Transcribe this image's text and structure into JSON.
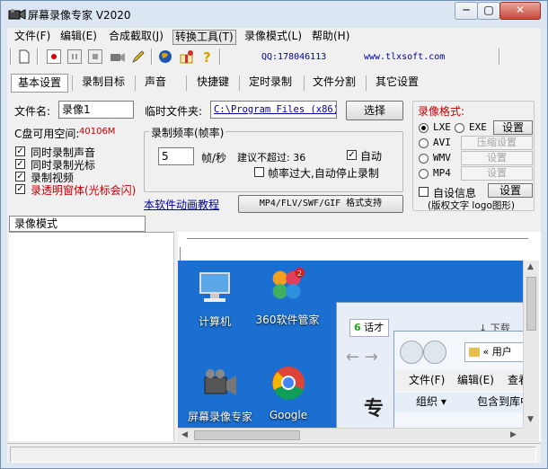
{
  "title": "屏幕录像专家 V2020",
  "window_controls": {
    "minimize": "─",
    "maximize": "▢",
    "close": "✕"
  },
  "menu": [
    "文件(F)",
    "编辑(E)",
    "合成截取(J)",
    "转换工具(T)",
    "录像模式(L)",
    "帮助(H)"
  ],
  "toolbar": {
    "qq": "QQ:178046113",
    "url": "www.tlxsoft.com"
  },
  "tabs": [
    "基本设置",
    "录制目标",
    "声音",
    "快捷键",
    "定时录制",
    "文件分割",
    "其它设置"
  ],
  "basic": {
    "filename_label": "文件名:",
    "filename_value": "录像1",
    "tempfolder_label": "临时文件夹:",
    "tempfolder_value": "C:\\Program Files (x86)\\",
    "browse_button": "选择",
    "disk_label": "C盘可用空间:",
    "disk_value": "40106M",
    "checkboxes": [
      {
        "label": "同时录制声音",
        "checked": true,
        "color": "#000000"
      },
      {
        "label": "同时录制光标",
        "checked": true,
        "color": "#000000"
      },
      {
        "label": "录制视频",
        "checked": true,
        "color": "#000000"
      },
      {
        "label": "录透明窗体(光标会闪)",
        "checked": true,
        "color": "#c00000"
      }
    ],
    "framerate": {
      "title": "录制频率(帧率)",
      "value": "5",
      "unit": "帧/秒",
      "suggest": "建议不超过: 36",
      "auto_label": "自动",
      "auto_checked": true,
      "stop_label": "帧率过大,自动停止录制",
      "stop_checked": false
    },
    "tutorial_link": "本软件动画教程",
    "format_button": "MP4/FLV/SWF/GIF  格式支持"
  },
  "format": {
    "title": "录像格式:",
    "options": [
      {
        "label": "LXE",
        "selected": true
      },
      {
        "label": "EXE",
        "selected": false
      },
      {
        "label": "AVI",
        "selected": false
      },
      {
        "label": "WMV",
        "selected": false
      },
      {
        "label": "MP4",
        "selected": false
      }
    ],
    "settings": "设置",
    "compress": "压缩设置",
    "custom_label": "自设信息",
    "custom_checked": false,
    "custom_button": "设置",
    "note": "(版权文字 logo图形)"
  },
  "recmode_tab": "录像模式",
  "desktop": {
    "icons": [
      "计算机",
      "360软件管家",
      "屏幕录像专家",
      "Google"
    ],
    "badge": "2",
    "browser_tabs": [
      "话才",
      "下载"
    ],
    "explorer": {
      "path": "用户",
      "menu": [
        "文件(F)",
        "编辑(E)",
        "查看"
      ],
      "toolbar": [
        "组织 ▾",
        "包含到库中"
      ]
    }
  },
  "colors": {
    "accent_red": "#c00000",
    "link_blue": "#0000a0",
    "desktop_blue": "#1a6fd0"
  }
}
